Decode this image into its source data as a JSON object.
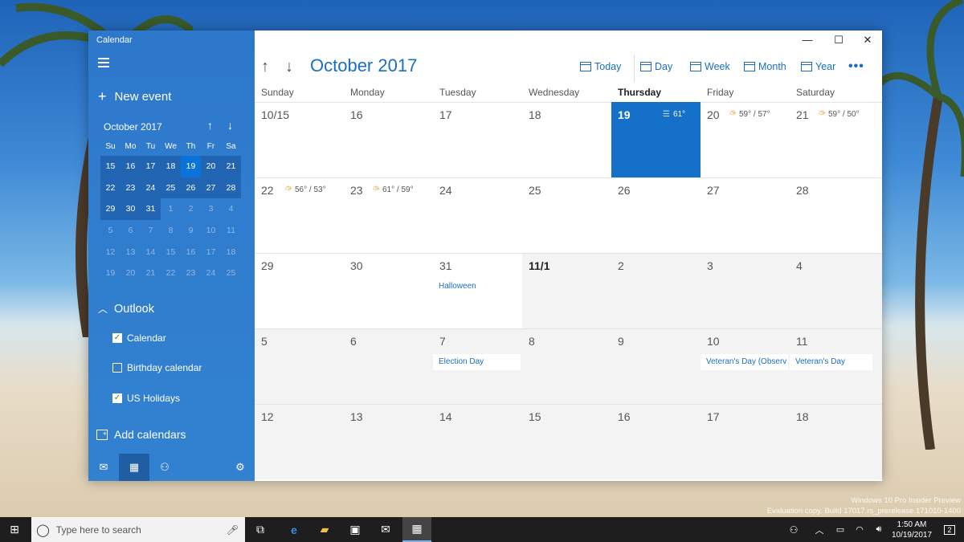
{
  "app": {
    "title": "Calendar"
  },
  "sidebar": {
    "new_event": "New event",
    "mini": {
      "month": "October 2017",
      "dow": [
        "Su",
        "Mo",
        "Tu",
        "We",
        "Th",
        "Fr",
        "Sa"
      ],
      "rows": [
        [
          "15",
          "16",
          "17",
          "18",
          "19",
          "20",
          "21"
        ],
        [
          "22",
          "23",
          "24",
          "25",
          "26",
          "27",
          "28"
        ],
        [
          "29",
          "30",
          "31",
          "1",
          "2",
          "3",
          "4"
        ],
        [
          "5",
          "6",
          "7",
          "8",
          "9",
          "10",
          "11"
        ],
        [
          "12",
          "13",
          "14",
          "15",
          "16",
          "17",
          "18"
        ],
        [
          "19",
          "20",
          "21",
          "22",
          "23",
          "24",
          "25"
        ]
      ]
    },
    "account": "Outlook",
    "calendars": [
      {
        "label": "Calendar",
        "checked": true
      },
      {
        "label": "Birthday calendar",
        "checked": false
      },
      {
        "label": "US Holidays",
        "checked": true
      }
    ],
    "add_calendars": "Add calendars"
  },
  "main": {
    "month_title": "October 2017",
    "views": {
      "today": "Today",
      "day": "Day",
      "week": "Week",
      "month": "Month",
      "year": "Year"
    },
    "days_of_week": [
      "Sunday",
      "Monday",
      "Tuesday",
      "Wednesday",
      "Thursday",
      "Friday",
      "Saturday"
    ],
    "weeks": [
      [
        {
          "d": "10/15"
        },
        {
          "d": "16"
        },
        {
          "d": "17"
        },
        {
          "d": "18"
        },
        {
          "d": "19",
          "today": true,
          "wx": "61°"
        },
        {
          "d": "20",
          "wx": "59° / 57°"
        },
        {
          "d": "21",
          "wx": "59° / 50°"
        }
      ],
      [
        {
          "d": "22",
          "wx": "56° / 53°"
        },
        {
          "d": "23",
          "wx": "61° / 59°"
        },
        {
          "d": "24"
        },
        {
          "d": "25"
        },
        {
          "d": "26"
        },
        {
          "d": "27"
        },
        {
          "d": "28"
        }
      ],
      [
        {
          "d": "29"
        },
        {
          "d": "30"
        },
        {
          "d": "31",
          "ev": "Halloween"
        },
        {
          "d": "11/1",
          "bold": true
        },
        {
          "d": "2"
        },
        {
          "d": "3"
        },
        {
          "d": "4"
        }
      ],
      [
        {
          "d": "5"
        },
        {
          "d": "6"
        },
        {
          "d": "7",
          "ev": "Election Day"
        },
        {
          "d": "8"
        },
        {
          "d": "9"
        },
        {
          "d": "10",
          "ev": "Veteran's Day (Observ"
        },
        {
          "d": "11",
          "ev": "Veteran's Day"
        }
      ],
      [
        {
          "d": "12"
        },
        {
          "d": "13"
        },
        {
          "d": "14"
        },
        {
          "d": "15"
        },
        {
          "d": "16"
        },
        {
          "d": "17"
        },
        {
          "d": "18"
        }
      ]
    ]
  },
  "taskbar": {
    "search_placeholder": "Type here to search",
    "time": "1:50 AM",
    "date": "10/19/2017",
    "notifications": "2"
  },
  "watermark": {
    "line1": "Windows 10 Pro Insider Preview",
    "line2": "Evaluation copy. Build 17017.rs_prerelease.171010-1400"
  },
  "colors": {
    "accent": "#1470c8",
    "sidebar": "#1e6ec8"
  }
}
